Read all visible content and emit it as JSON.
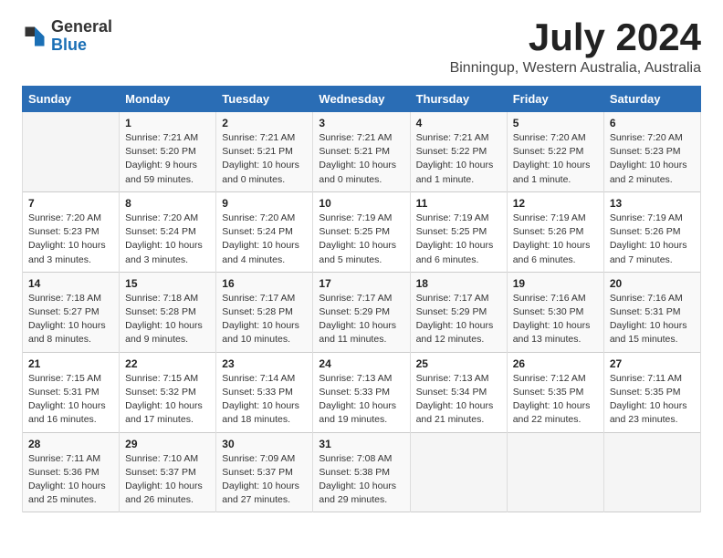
{
  "header": {
    "logo_general": "General",
    "logo_blue": "Blue",
    "month_title": "July 2024",
    "location": "Binningup, Western Australia, Australia"
  },
  "days_of_week": [
    "Sunday",
    "Monday",
    "Tuesday",
    "Wednesday",
    "Thursday",
    "Friday",
    "Saturday"
  ],
  "weeks": [
    [
      {
        "day": "",
        "info": ""
      },
      {
        "day": "1",
        "info": "Sunrise: 7:21 AM\nSunset: 5:20 PM\nDaylight: 9 hours\nand 59 minutes."
      },
      {
        "day": "2",
        "info": "Sunrise: 7:21 AM\nSunset: 5:21 PM\nDaylight: 10 hours\nand 0 minutes."
      },
      {
        "day": "3",
        "info": "Sunrise: 7:21 AM\nSunset: 5:21 PM\nDaylight: 10 hours\nand 0 minutes."
      },
      {
        "day": "4",
        "info": "Sunrise: 7:21 AM\nSunset: 5:22 PM\nDaylight: 10 hours\nand 1 minute."
      },
      {
        "day": "5",
        "info": "Sunrise: 7:20 AM\nSunset: 5:22 PM\nDaylight: 10 hours\nand 1 minute."
      },
      {
        "day": "6",
        "info": "Sunrise: 7:20 AM\nSunset: 5:23 PM\nDaylight: 10 hours\nand 2 minutes."
      }
    ],
    [
      {
        "day": "7",
        "info": "Sunrise: 7:20 AM\nSunset: 5:23 PM\nDaylight: 10 hours\nand 3 minutes."
      },
      {
        "day": "8",
        "info": "Sunrise: 7:20 AM\nSunset: 5:24 PM\nDaylight: 10 hours\nand 3 minutes."
      },
      {
        "day": "9",
        "info": "Sunrise: 7:20 AM\nSunset: 5:24 PM\nDaylight: 10 hours\nand 4 minutes."
      },
      {
        "day": "10",
        "info": "Sunrise: 7:19 AM\nSunset: 5:25 PM\nDaylight: 10 hours\nand 5 minutes."
      },
      {
        "day": "11",
        "info": "Sunrise: 7:19 AM\nSunset: 5:25 PM\nDaylight: 10 hours\nand 6 minutes."
      },
      {
        "day": "12",
        "info": "Sunrise: 7:19 AM\nSunset: 5:26 PM\nDaylight: 10 hours\nand 6 minutes."
      },
      {
        "day": "13",
        "info": "Sunrise: 7:19 AM\nSunset: 5:26 PM\nDaylight: 10 hours\nand 7 minutes."
      }
    ],
    [
      {
        "day": "14",
        "info": "Sunrise: 7:18 AM\nSunset: 5:27 PM\nDaylight: 10 hours\nand 8 minutes."
      },
      {
        "day": "15",
        "info": "Sunrise: 7:18 AM\nSunset: 5:28 PM\nDaylight: 10 hours\nand 9 minutes."
      },
      {
        "day": "16",
        "info": "Sunrise: 7:17 AM\nSunset: 5:28 PM\nDaylight: 10 hours\nand 10 minutes."
      },
      {
        "day": "17",
        "info": "Sunrise: 7:17 AM\nSunset: 5:29 PM\nDaylight: 10 hours\nand 11 minutes."
      },
      {
        "day": "18",
        "info": "Sunrise: 7:17 AM\nSunset: 5:29 PM\nDaylight: 10 hours\nand 12 minutes."
      },
      {
        "day": "19",
        "info": "Sunrise: 7:16 AM\nSunset: 5:30 PM\nDaylight: 10 hours\nand 13 minutes."
      },
      {
        "day": "20",
        "info": "Sunrise: 7:16 AM\nSunset: 5:31 PM\nDaylight: 10 hours\nand 15 minutes."
      }
    ],
    [
      {
        "day": "21",
        "info": "Sunrise: 7:15 AM\nSunset: 5:31 PM\nDaylight: 10 hours\nand 16 minutes."
      },
      {
        "day": "22",
        "info": "Sunrise: 7:15 AM\nSunset: 5:32 PM\nDaylight: 10 hours\nand 17 minutes."
      },
      {
        "day": "23",
        "info": "Sunrise: 7:14 AM\nSunset: 5:33 PM\nDaylight: 10 hours\nand 18 minutes."
      },
      {
        "day": "24",
        "info": "Sunrise: 7:13 AM\nSunset: 5:33 PM\nDaylight: 10 hours\nand 19 minutes."
      },
      {
        "day": "25",
        "info": "Sunrise: 7:13 AM\nSunset: 5:34 PM\nDaylight: 10 hours\nand 21 minutes."
      },
      {
        "day": "26",
        "info": "Sunrise: 7:12 AM\nSunset: 5:35 PM\nDaylight: 10 hours\nand 22 minutes."
      },
      {
        "day": "27",
        "info": "Sunrise: 7:11 AM\nSunset: 5:35 PM\nDaylight: 10 hours\nand 23 minutes."
      }
    ],
    [
      {
        "day": "28",
        "info": "Sunrise: 7:11 AM\nSunset: 5:36 PM\nDaylight: 10 hours\nand 25 minutes."
      },
      {
        "day": "29",
        "info": "Sunrise: 7:10 AM\nSunset: 5:37 PM\nDaylight: 10 hours\nand 26 minutes."
      },
      {
        "day": "30",
        "info": "Sunrise: 7:09 AM\nSunset: 5:37 PM\nDaylight: 10 hours\nand 27 minutes."
      },
      {
        "day": "31",
        "info": "Sunrise: 7:08 AM\nSunset: 5:38 PM\nDaylight: 10 hours\nand 29 minutes."
      },
      {
        "day": "",
        "info": ""
      },
      {
        "day": "",
        "info": ""
      },
      {
        "day": "",
        "info": ""
      }
    ]
  ]
}
